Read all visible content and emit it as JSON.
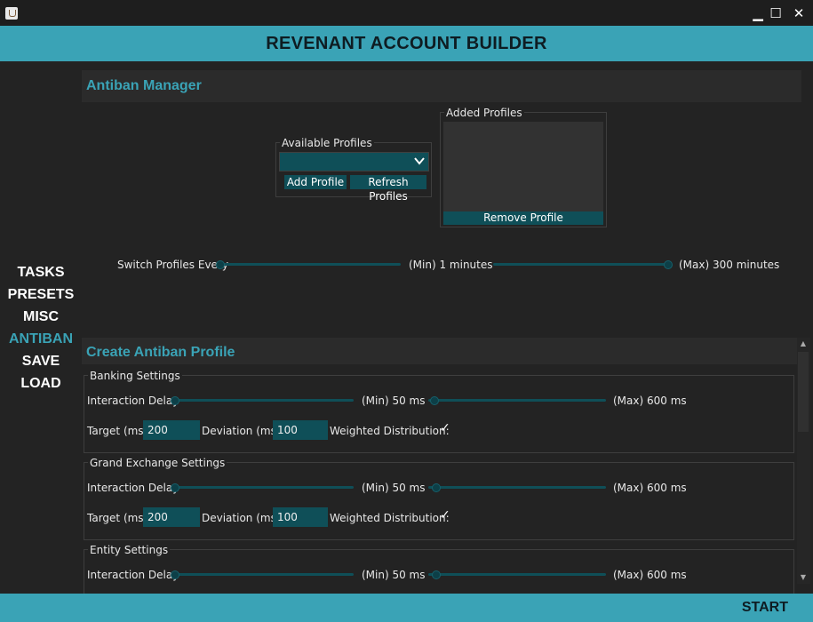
{
  "window": {
    "minimize": "▁",
    "maximize": "☐",
    "close": "✕"
  },
  "app": {
    "title": "REVENANT ACCOUNT BUILDER"
  },
  "nav": {
    "items": [
      {
        "label": "TASKS"
      },
      {
        "label": "PRESETS"
      },
      {
        "label": "MISC"
      },
      {
        "label": "ANTIBAN"
      },
      {
        "label": "SAVE"
      },
      {
        "label": "LOAD"
      }
    ],
    "active": "ANTIBAN"
  },
  "antiban_manager": {
    "title": "Antiban Manager",
    "available_profiles": {
      "legend": "Available Profiles",
      "selected": "",
      "add_label": "Add Profile",
      "refresh_label": "Refresh Profiles"
    },
    "added_profiles": {
      "legend": "Added Profiles",
      "remove_label": "Remove Profile"
    },
    "switch": {
      "label": "Switch Profiles Every",
      "min_label": "(Min) 1 minutes",
      "max_label": "(Max) 300 minutes",
      "min_value": 1,
      "max_value": 300
    }
  },
  "create_profile": {
    "title": "Create Antiban Profile",
    "groups": [
      {
        "legend": "Banking Settings",
        "delay_label": "Interaction Delay",
        "min_label": "(Min) 50 ms",
        "max_label": "(Max) 600 ms",
        "target_label": "Target (ms):",
        "target_value": "200",
        "deviation_label": "Deviation (ms):",
        "deviation_value": "100",
        "weighted_label": "Weighted Distribution:",
        "weighted_checked": true
      },
      {
        "legend": "Grand Exchange Settings",
        "delay_label": "Interaction Delay",
        "min_label": "(Min) 50 ms",
        "max_label": "(Max) 600 ms",
        "target_label": "Target (ms):",
        "target_value": "200",
        "deviation_label": "Deviation (ms):",
        "deviation_value": "100",
        "weighted_label": "Weighted Distribution:",
        "weighted_checked": true
      },
      {
        "legend": "Entity Settings",
        "delay_label": "Interaction Delay",
        "min_label": "(Min) 50 ms",
        "max_label": "(Max) 600 ms"
      }
    ]
  },
  "footer": {
    "start_label": "START"
  },
  "icons": {
    "app": "java-cup-icon",
    "dropdown": "chevron-down-icon",
    "check": "✓",
    "scroll_up": "▲",
    "scroll_down": "▼",
    "chevron": "⌄"
  },
  "colors": {
    "accent": "#3aa3b6",
    "control": "#0f4f58",
    "background": "#232323"
  }
}
